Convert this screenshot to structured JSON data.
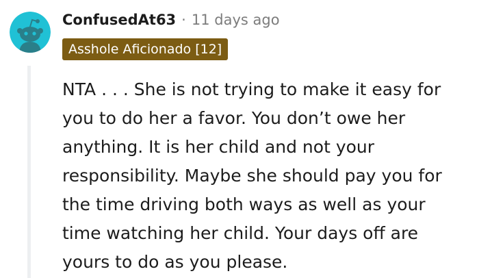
{
  "comment": {
    "username": "ConfusedAt63",
    "separator": "·",
    "timestamp": "11 days ago",
    "flair": "Asshole Aficionado [12]",
    "flair_color": "#7c5c13",
    "avatar_icon": "snoo-avatar-icon",
    "avatar_color": "#20c1d5",
    "body": "NTA . . . She is not trying to make it easy for you to do her a favor. You don’t owe her anything. It is her child and not your responsibility. Maybe she should pay you for the time driving both ways as well as your time watching her child. Your days off are yours to do as you please."
  }
}
